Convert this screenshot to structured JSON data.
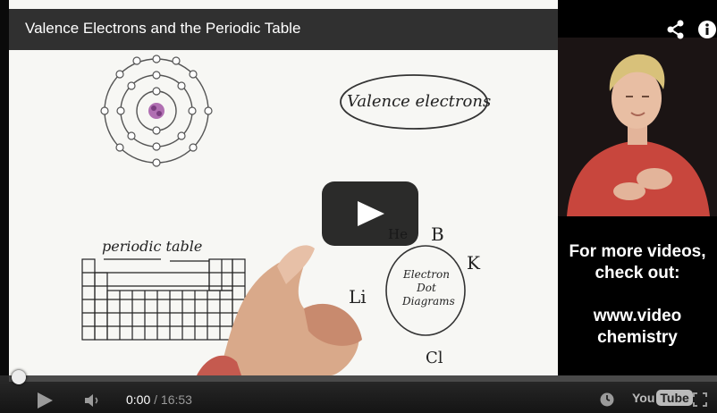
{
  "video": {
    "title": "Valence Electrons and the Periodic Table"
  },
  "whiteboard": {
    "valence_label": "Valence electrons",
    "periodic_label": "periodic table",
    "dot_label_line1": "Electron",
    "dot_label_line2": "Dot",
    "dot_label_line3": "Diagrams",
    "elements": [
      "B",
      "He",
      "K",
      "Li",
      "Cl"
    ]
  },
  "promo": {
    "line1": "For more videos,",
    "line2": "check out:",
    "url1": "www.video",
    "url2": "chemistry"
  },
  "controls": {
    "current_time": "0:00",
    "separator": " / ",
    "duration": "16:53",
    "progress_fraction": 0.0,
    "logo_you": "You",
    "logo_tube": "Tube"
  },
  "icons": {
    "share": "share-icon",
    "info": "info-icon",
    "play": "play-icon",
    "volume": "volume-icon",
    "watch_later": "clock-icon",
    "fullscreen": "fullscreen-icon"
  }
}
